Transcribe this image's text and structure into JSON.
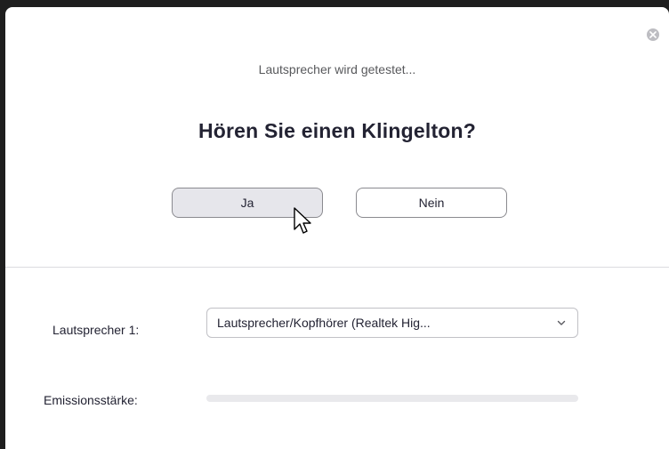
{
  "dialog": {
    "subtitle": "Lautsprecher wird getestet...",
    "headline": "Hören Sie einen Klingelton?",
    "yes_label": "Ja",
    "no_label": "Nein"
  },
  "settings": {
    "speaker_label": "Lautsprecher 1:",
    "speaker_value": "Lautsprecher/Kopfhörer (Realtek Hig...",
    "level_label": "Emissionsstärke:",
    "level_fraction": 0.0
  },
  "colors": {
    "accent": "#2d8cff",
    "close_button": "#bdbdc2",
    "text_primary": "#232333"
  },
  "icons": {
    "close": "close-icon",
    "dropdown": "chevron-down-icon",
    "pointer": "mouse-cursor-icon"
  }
}
